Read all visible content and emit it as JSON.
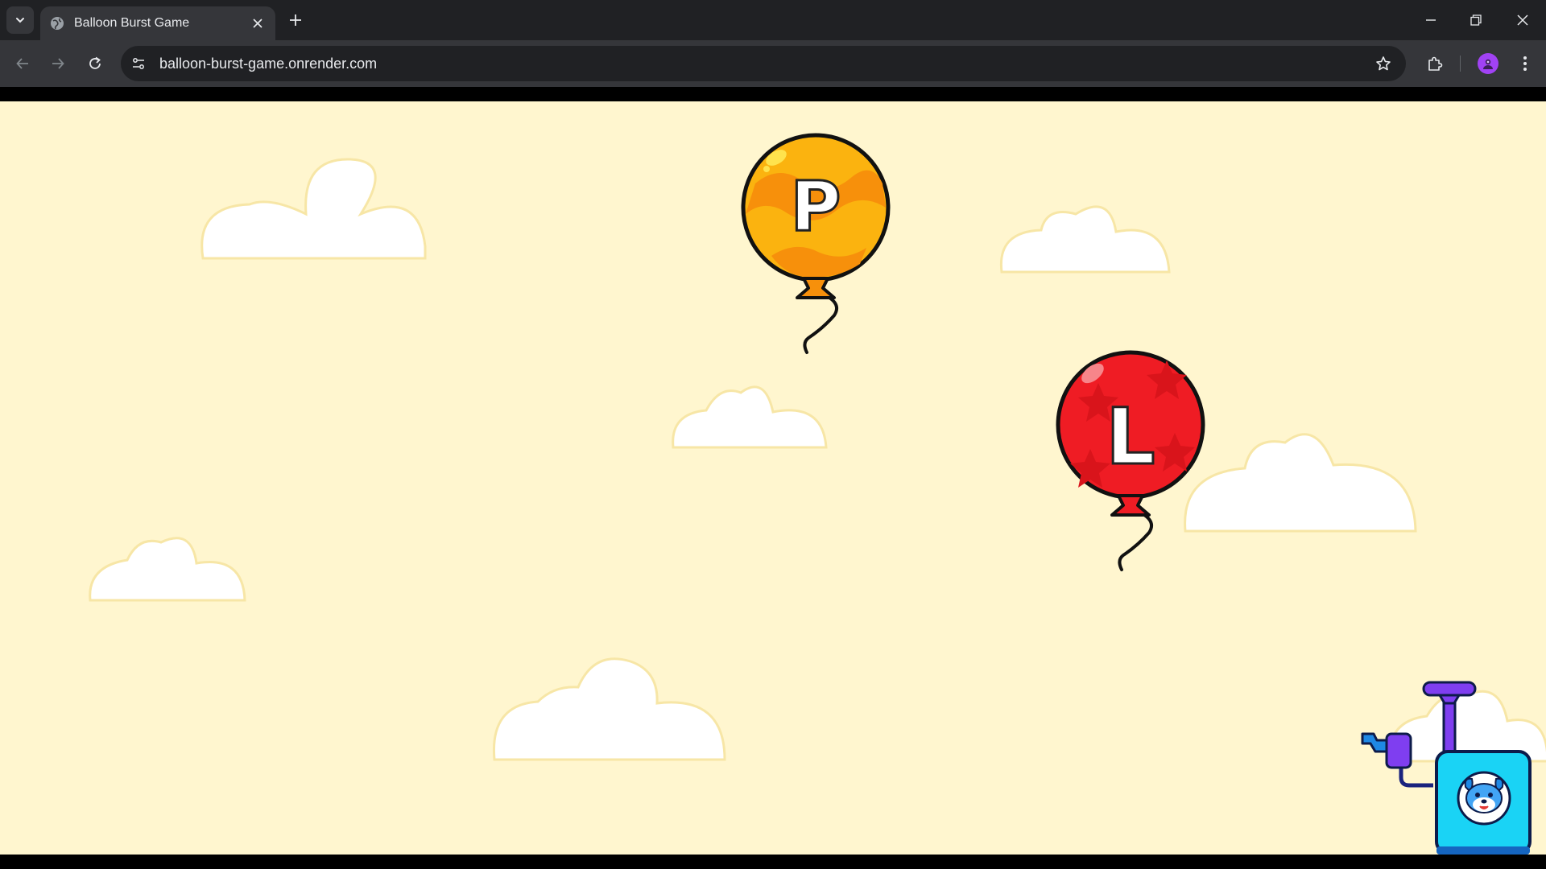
{
  "browser": {
    "tab_title": "Balloon Burst Game",
    "url": "balloon-burst-game.onrender.com",
    "icons": {
      "tab_search": "chevron-down-icon",
      "favicon": "globe-icon",
      "tab_close": "close-icon",
      "new_tab": "plus-icon",
      "minimize": "minimize-icon",
      "restore": "restore-icon",
      "close_window": "close-icon",
      "back": "back-arrow-icon",
      "forward": "forward-arrow-icon",
      "reload": "reload-icon",
      "site_info": "tune-icon",
      "bookmark": "star-icon",
      "extensions": "puzzle-icon",
      "profile": "avatar",
      "menu": "kebab-menu-icon"
    }
  },
  "game": {
    "background_color": "#fff6cf",
    "balloons": [
      {
        "letter": "P",
        "color": "#fbb30f",
        "pattern_color": "#f7900b"
      },
      {
        "letter": "L",
        "color": "#ef1c24",
        "pattern_color": "#d9141b"
      }
    ],
    "pump": {
      "body_color": "#1ad3f5",
      "handle_color": "#7f3ef0",
      "mascot": "blue-dog-mascot-icon"
    }
  }
}
